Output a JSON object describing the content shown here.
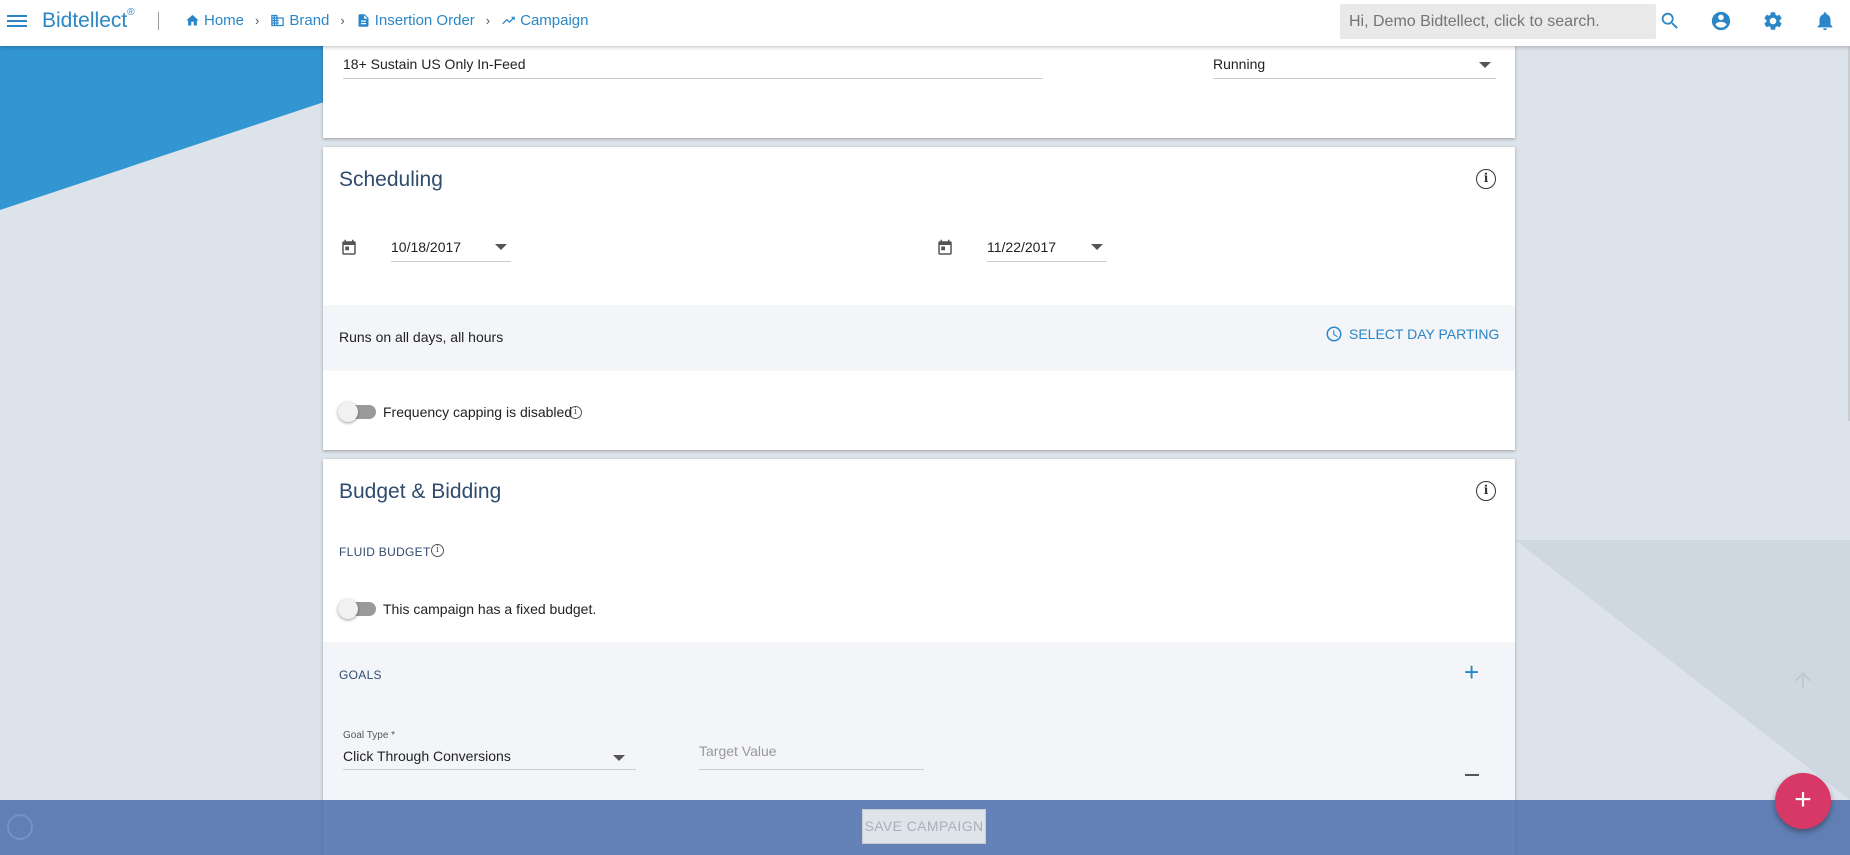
{
  "app": {
    "brand": "Bidtellect",
    "brand_mark": "®"
  },
  "breadcrumbs": [
    {
      "label": "Home",
      "icon": "home-icon"
    },
    {
      "label": "Brand",
      "icon": "building-icon"
    },
    {
      "label": "Insertion Order",
      "icon": "document-icon"
    },
    {
      "label": "Campaign",
      "icon": "trend-icon"
    }
  ],
  "search": {
    "placeholder": "Hi, Demo Bidtellect, click to search."
  },
  "campaign": {
    "name": "18+ Sustain US Only In-Feed",
    "status": "Running"
  },
  "scheduling": {
    "title": "Scheduling",
    "start_date": "10/18/2017",
    "end_date": "11/22/2017",
    "runs_text": "Runs on all days, all hours",
    "day_parting_label": "SELECT DAY PARTING",
    "frequency_text": "Frequency capping is disabled"
  },
  "budget": {
    "title": "Budget & Bidding",
    "fluid_label": "FLUID BUDGET",
    "fixed_text": "This campaign has a fixed budget.",
    "goals_label": "GOALS",
    "goal_type_label": "Goal Type *",
    "goal_type_value": "Click Through Conversions",
    "target_placeholder": "Target Value"
  },
  "actions": {
    "save_label": "SAVE CAMPAIGN",
    "fab_label": "+"
  },
  "colors": {
    "accent": "#2a86c6",
    "fab": "#d73866",
    "bottombar": "#4669aa"
  }
}
